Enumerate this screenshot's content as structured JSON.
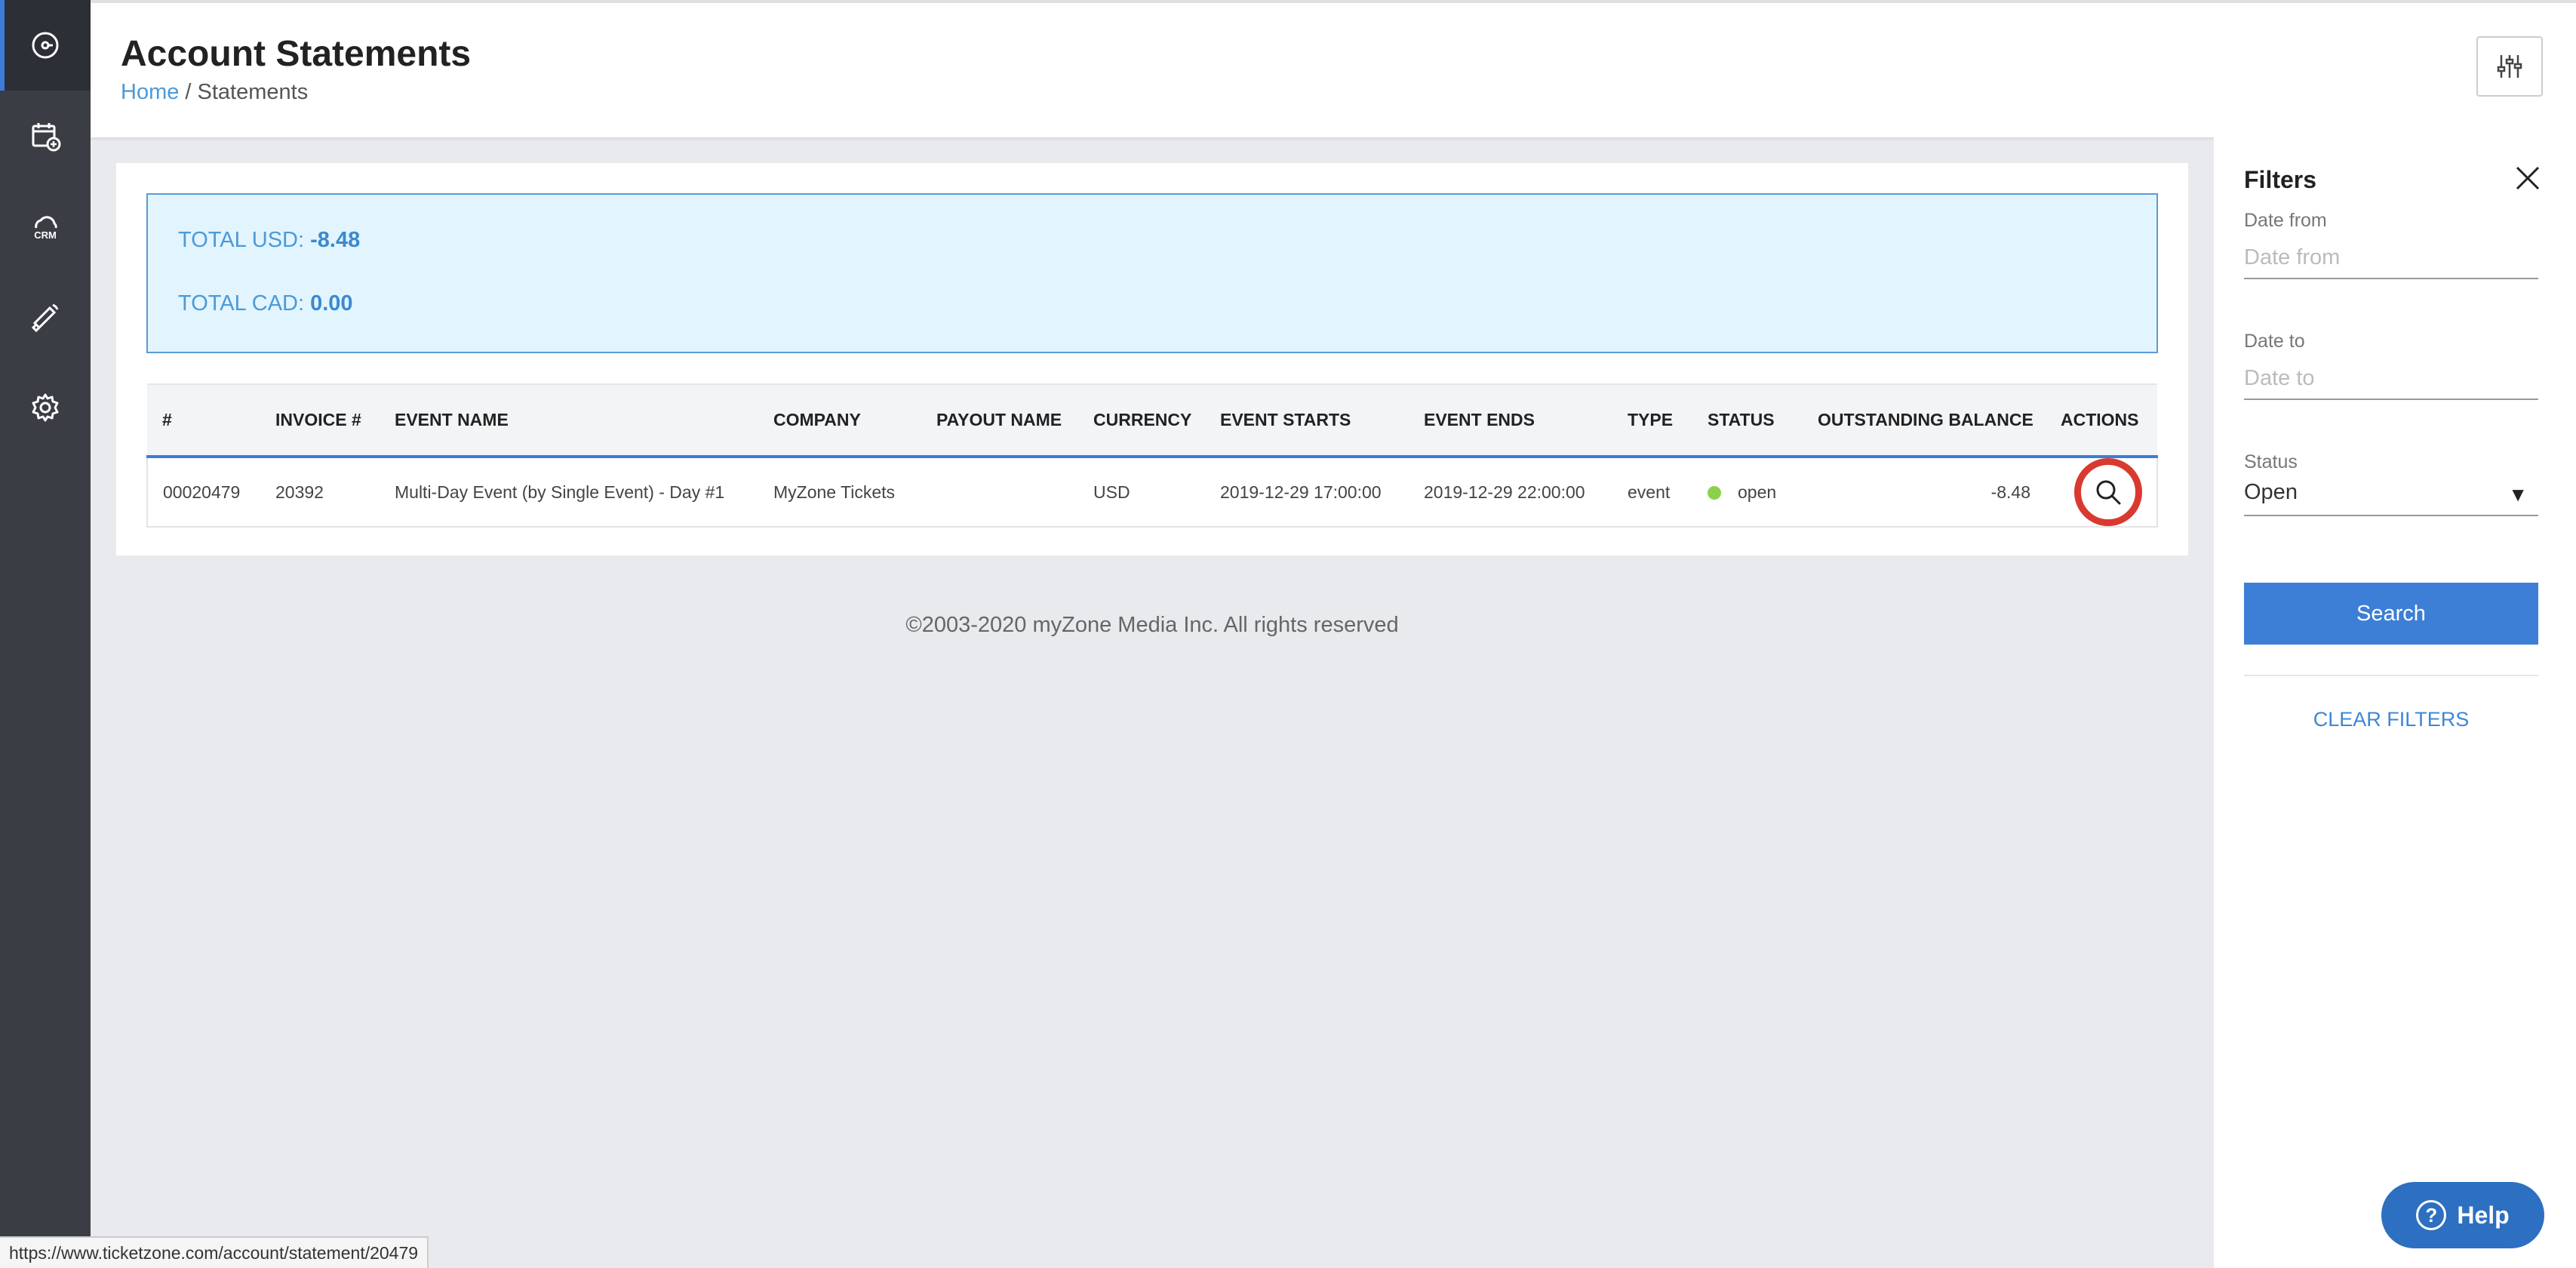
{
  "sidebar": {
    "items": [
      {
        "icon": "dashboard-icon"
      },
      {
        "icon": "calendar-add-icon"
      },
      {
        "icon": "crm-cloud-icon",
        "label": "CRM"
      },
      {
        "icon": "megaphone-icon"
      },
      {
        "icon": "gear-icon"
      }
    ]
  },
  "header": {
    "title": "Account Statements",
    "breadcrumb": {
      "home": "Home",
      "separator": " / ",
      "current": "Statements"
    }
  },
  "totals": {
    "usd_label": "TOTAL USD: ",
    "usd_value": "-8.48",
    "cad_label": "TOTAL CAD: ",
    "cad_value": "0.00"
  },
  "table": {
    "headers": [
      "#",
      "INVOICE #",
      "EVENT NAME",
      "COMPANY",
      "PAYOUT NAME",
      "CURRENCY",
      "EVENT STARTS",
      "EVENT ENDS",
      "TYPE",
      "STATUS",
      "OUTSTANDING BALANCE",
      "ACTIONS"
    ],
    "rows": [
      {
        "id": "00020479",
        "invoice": "20392",
        "event_name": "Multi-Day Event (by Single Event) - Day #1",
        "company": "MyZone Tickets",
        "payout_name": "",
        "currency": "USD",
        "event_starts": "2019-12-29 17:00:00",
        "event_ends": "2019-12-29 22:00:00",
        "type": "event",
        "status": "open",
        "outstanding_balance": "-8.48"
      }
    ]
  },
  "footer": {
    "copyright": "©2003-2020 myZone Media Inc. All rights reserved"
  },
  "filters": {
    "title": "Filters",
    "date_from_label": "Date from",
    "date_from_placeholder": "Date from",
    "date_to_label": "Date to",
    "date_to_placeholder": "Date to",
    "status_label": "Status",
    "status_value": "Open",
    "search_label": "Search",
    "clear_label": "CLEAR FILTERS"
  },
  "help": {
    "label": "Help",
    "glyph": "?"
  },
  "status_bar": {
    "url": "https://www.ticketzone.com/account/statement/20479"
  },
  "colors": {
    "accent": "#3d7fd6",
    "sidebar": "#3a3d44",
    "status_open": "#8bd14a",
    "highlight_ring": "#d93a2f"
  }
}
